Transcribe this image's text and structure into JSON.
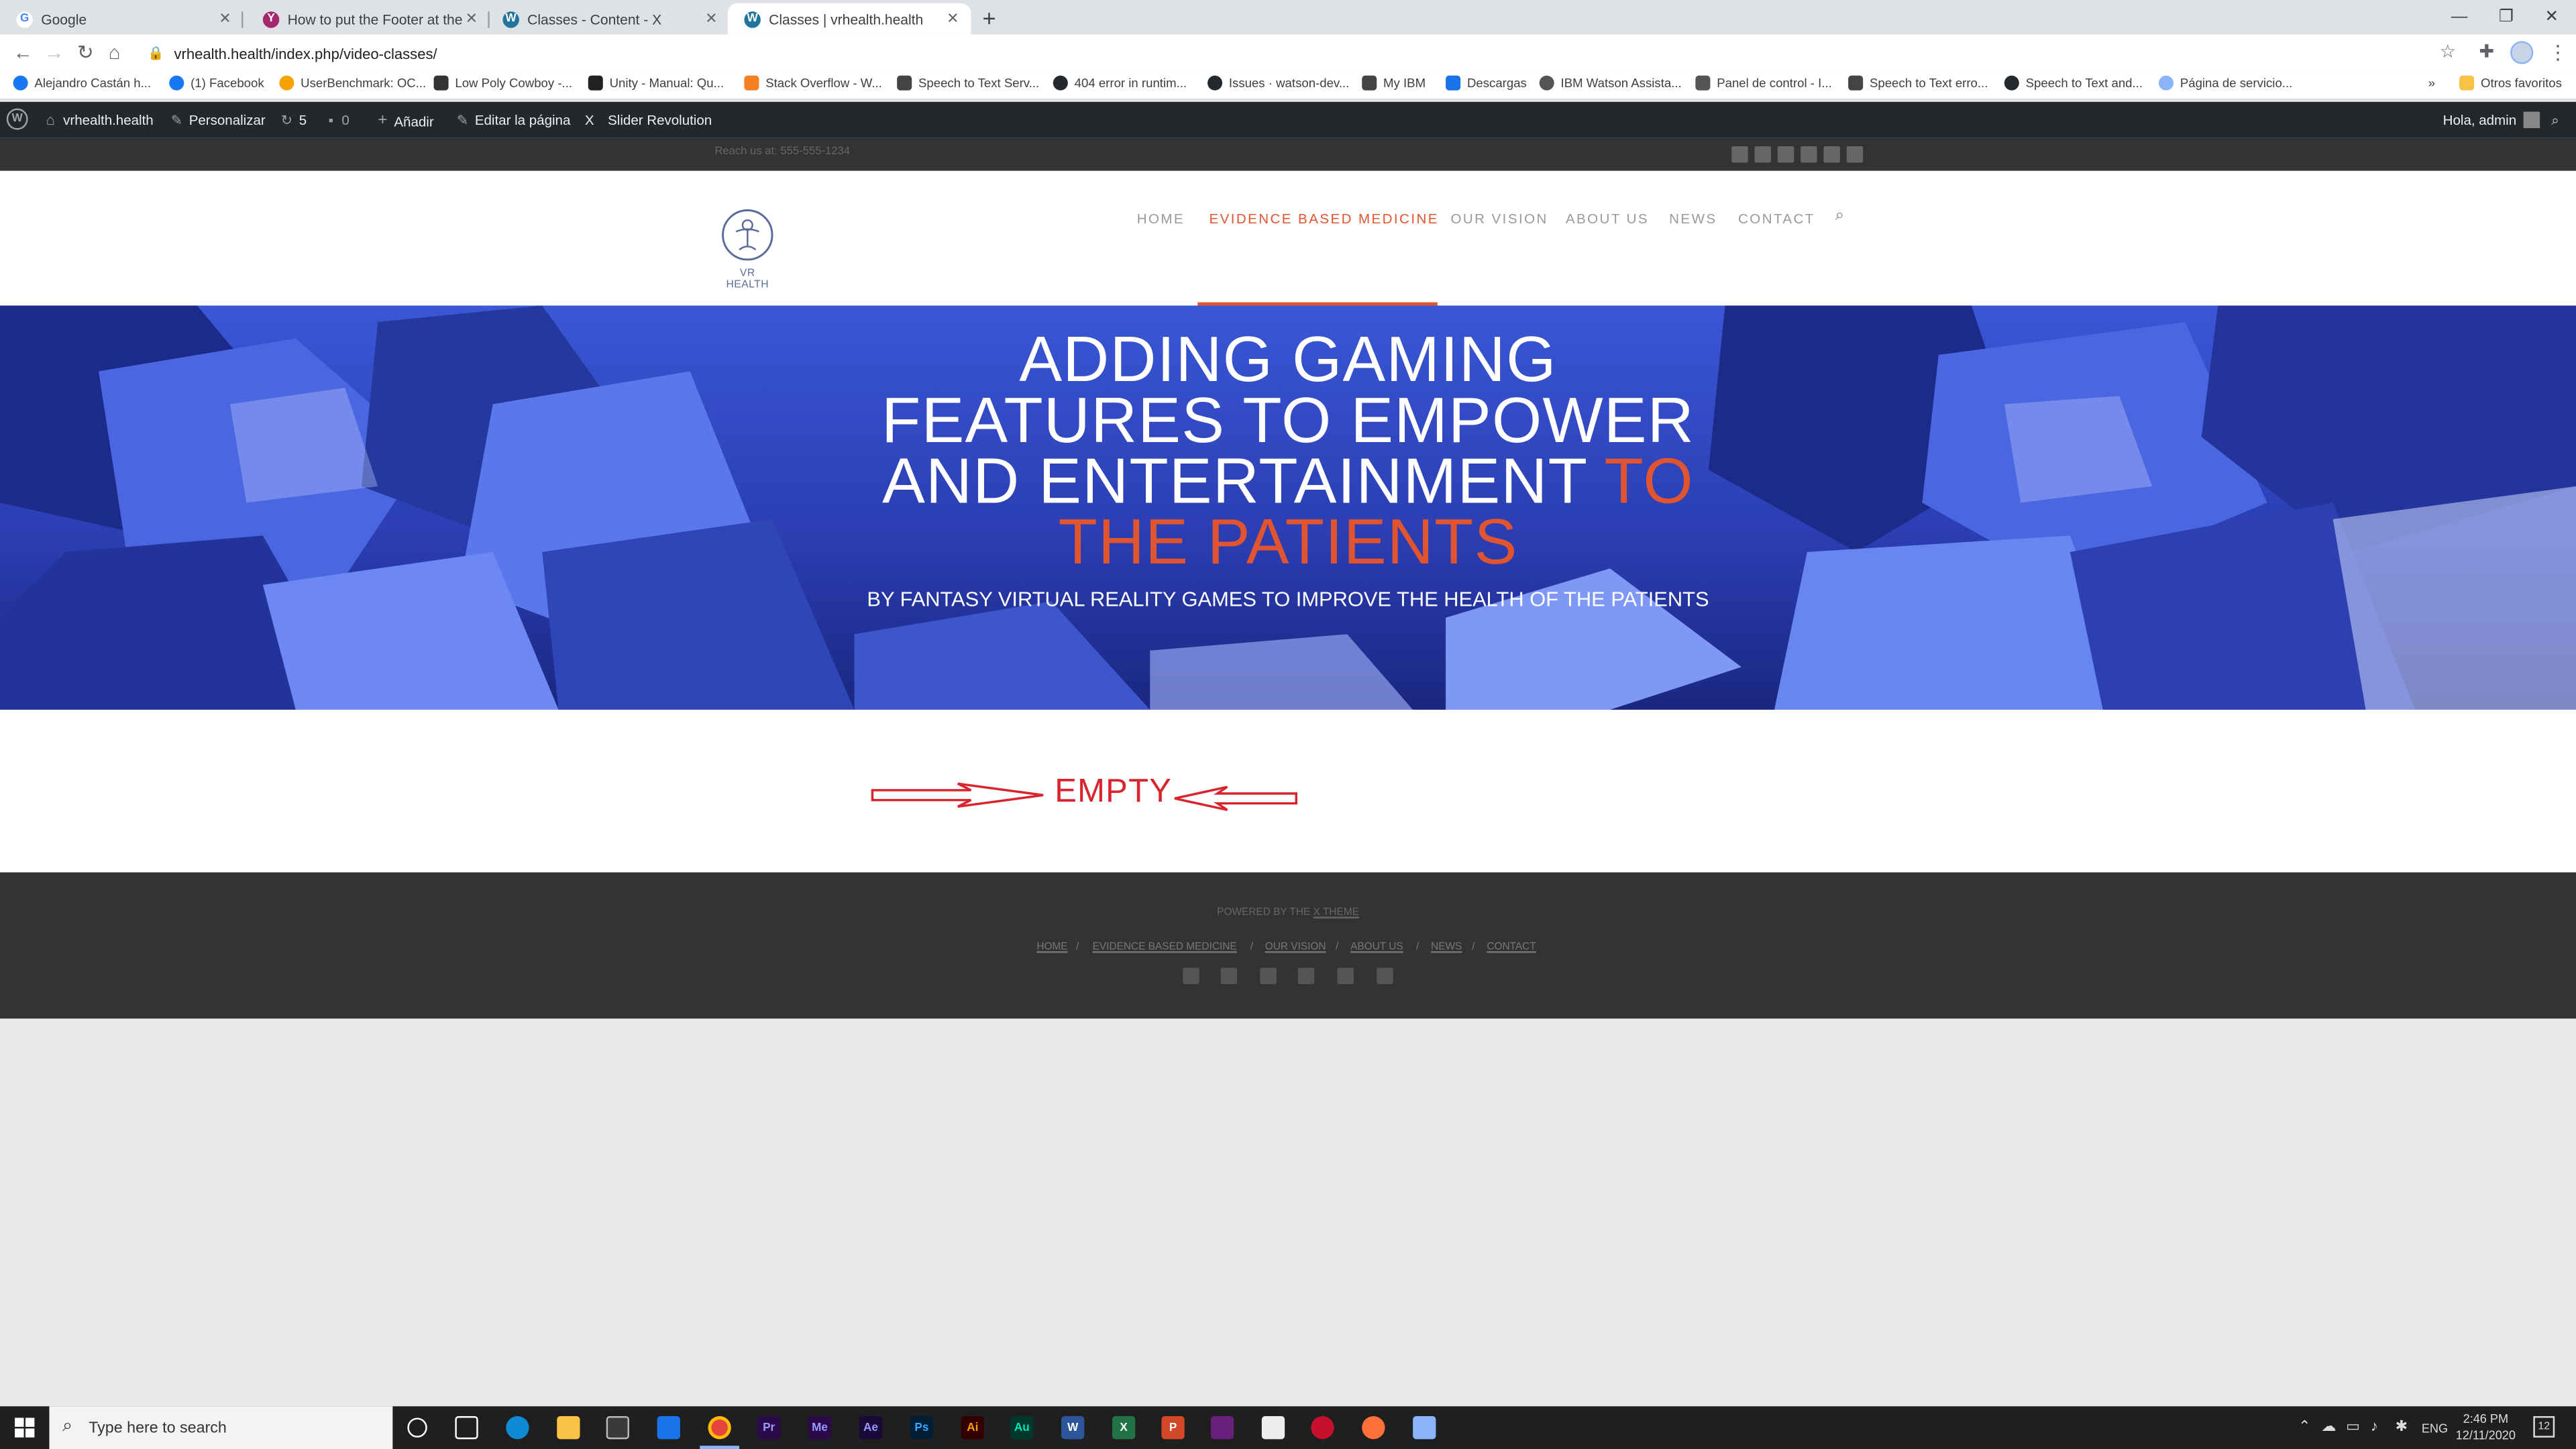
{
  "browser": {
    "tabs": [
      {
        "title": "Google",
        "icon": "google-icon",
        "color": "#4285f4"
      },
      {
        "title": "How to put the Footer at the Pag",
        "icon": "yoast-icon",
        "color": "#a4286a"
      },
      {
        "title": "Classes - Content - X",
        "icon": "wordpress-icon",
        "color": "#21759b"
      },
      {
        "title": "Classes | vrhealth.health",
        "icon": "wordpress-icon",
        "color": "#21759b"
      }
    ],
    "new_tab_label": "+",
    "url": "vrhealth.health/index.php/video-classes/",
    "bookmarks": [
      "Alejandro Castán h...",
      "(1) Facebook",
      "UserBenchmark: OC...",
      "Low Poly Cowboy -...",
      "Unity - Manual: Qu...",
      "Stack Overflow - W...",
      "Speech to Text Serv...",
      "404 error in runtim...",
      "Issues · watson-dev...",
      "My IBM",
      "Descargas",
      "IBM Watson Assista...",
      "Panel de control - I...",
      "Speech to Text erro...",
      "Speech to Text and...",
      "Página de servicio..."
    ],
    "more_bookmarks": "»",
    "other_favorites": "Otros favoritos"
  },
  "wp_admin_bar": {
    "site": "vrhealth.health",
    "customize": "Personalizar",
    "updates_count": "5",
    "comments_count": "0",
    "add_new": "Añadir",
    "edit_page": "Editar la página",
    "x_label": "X",
    "slider": "Slider Revolution",
    "greeting": "Hola, admin"
  },
  "site": {
    "reach_us": "Reach us at: 555-555-1234",
    "logo_text": "VR HEALTH",
    "nav": [
      "HOME",
      "EVIDENCE BASED MEDICINE",
      "OUR VISION",
      "ABOUT US",
      "NEWS",
      "CONTACT"
    ],
    "hero": {
      "line1": "ADDING GAMING",
      "line2": "FEATURES TO EMPOWER",
      "line3_a": "AND ENTERTAINMENT ",
      "line3_b": "TO",
      "line4": "THE PATIENTS",
      "subtitle": "BY FANTASY VIRTUAL REALITY GAMES TO IMPROVE THE HEALTH OF THE PATIENTS"
    },
    "annotation": "EMPTY",
    "footer": {
      "powered_prefix": "POWERED BY THE ",
      "powered_link": "X THEME",
      "links": [
        "HOME",
        "EVIDENCE BASED MEDICINE",
        "OUR VISION",
        "ABOUT US",
        "NEWS",
        "CONTACT"
      ],
      "separator": "/"
    }
  },
  "taskbar": {
    "search_placeholder": "Type here to search",
    "apps": [
      "Pr",
      "Me",
      "Ae",
      "Ps",
      "Ai",
      "Au",
      "W",
      "X",
      "P"
    ],
    "lang": "ENG",
    "time": "2:46 PM",
    "date": "12/11/2020",
    "notifications": "12"
  },
  "colors": {
    "accent": "#e0552f",
    "wp_bar": "#23282d",
    "topbar": "#333333",
    "hero_blue": "#2b3fae",
    "annotation_red": "#d9232d"
  }
}
